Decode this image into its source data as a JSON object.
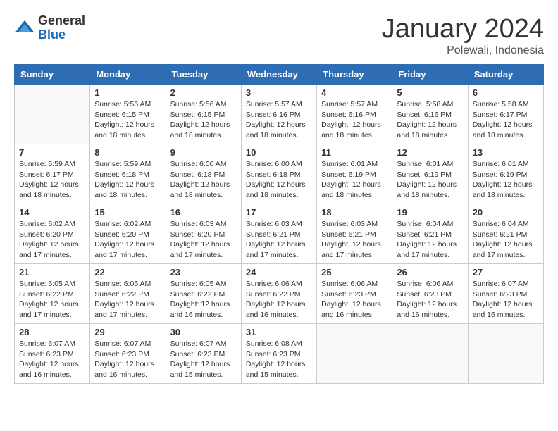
{
  "logo": {
    "general": "General",
    "blue": "Blue"
  },
  "title": "January 2024",
  "location": "Polewali, Indonesia",
  "days_of_week": [
    "Sunday",
    "Monday",
    "Tuesday",
    "Wednesday",
    "Thursday",
    "Friday",
    "Saturday"
  ],
  "weeks": [
    [
      {
        "day": "",
        "sunrise": "",
        "sunset": "",
        "daylight": ""
      },
      {
        "day": "1",
        "sunrise": "Sunrise: 5:56 AM",
        "sunset": "Sunset: 6:15 PM",
        "daylight": "Daylight: 12 hours and 18 minutes."
      },
      {
        "day": "2",
        "sunrise": "Sunrise: 5:56 AM",
        "sunset": "Sunset: 6:15 PM",
        "daylight": "Daylight: 12 hours and 18 minutes."
      },
      {
        "day": "3",
        "sunrise": "Sunrise: 5:57 AM",
        "sunset": "Sunset: 6:16 PM",
        "daylight": "Daylight: 12 hours and 18 minutes."
      },
      {
        "day": "4",
        "sunrise": "Sunrise: 5:57 AM",
        "sunset": "Sunset: 6:16 PM",
        "daylight": "Daylight: 12 hours and 18 minutes."
      },
      {
        "day": "5",
        "sunrise": "Sunrise: 5:58 AM",
        "sunset": "Sunset: 6:16 PM",
        "daylight": "Daylight: 12 hours and 18 minutes."
      },
      {
        "day": "6",
        "sunrise": "Sunrise: 5:58 AM",
        "sunset": "Sunset: 6:17 PM",
        "daylight": "Daylight: 12 hours and 18 minutes."
      }
    ],
    [
      {
        "day": "7",
        "sunrise": "Sunrise: 5:59 AM",
        "sunset": "Sunset: 6:17 PM",
        "daylight": "Daylight: 12 hours and 18 minutes."
      },
      {
        "day": "8",
        "sunrise": "Sunrise: 5:59 AM",
        "sunset": "Sunset: 6:18 PM",
        "daylight": "Daylight: 12 hours and 18 minutes."
      },
      {
        "day": "9",
        "sunrise": "Sunrise: 6:00 AM",
        "sunset": "Sunset: 6:18 PM",
        "daylight": "Daylight: 12 hours and 18 minutes."
      },
      {
        "day": "10",
        "sunrise": "Sunrise: 6:00 AM",
        "sunset": "Sunset: 6:18 PM",
        "daylight": "Daylight: 12 hours and 18 minutes."
      },
      {
        "day": "11",
        "sunrise": "Sunrise: 6:01 AM",
        "sunset": "Sunset: 6:19 PM",
        "daylight": "Daylight: 12 hours and 18 minutes."
      },
      {
        "day": "12",
        "sunrise": "Sunrise: 6:01 AM",
        "sunset": "Sunset: 6:19 PM",
        "daylight": "Daylight: 12 hours and 18 minutes."
      },
      {
        "day": "13",
        "sunrise": "Sunrise: 6:01 AM",
        "sunset": "Sunset: 6:19 PM",
        "daylight": "Daylight: 12 hours and 18 minutes."
      }
    ],
    [
      {
        "day": "14",
        "sunrise": "Sunrise: 6:02 AM",
        "sunset": "Sunset: 6:20 PM",
        "daylight": "Daylight: 12 hours and 17 minutes."
      },
      {
        "day": "15",
        "sunrise": "Sunrise: 6:02 AM",
        "sunset": "Sunset: 6:20 PM",
        "daylight": "Daylight: 12 hours and 17 minutes."
      },
      {
        "day": "16",
        "sunrise": "Sunrise: 6:03 AM",
        "sunset": "Sunset: 6:20 PM",
        "daylight": "Daylight: 12 hours and 17 minutes."
      },
      {
        "day": "17",
        "sunrise": "Sunrise: 6:03 AM",
        "sunset": "Sunset: 6:21 PM",
        "daylight": "Daylight: 12 hours and 17 minutes."
      },
      {
        "day": "18",
        "sunrise": "Sunrise: 6:03 AM",
        "sunset": "Sunset: 6:21 PM",
        "daylight": "Daylight: 12 hours and 17 minutes."
      },
      {
        "day": "19",
        "sunrise": "Sunrise: 6:04 AM",
        "sunset": "Sunset: 6:21 PM",
        "daylight": "Daylight: 12 hours and 17 minutes."
      },
      {
        "day": "20",
        "sunrise": "Sunrise: 6:04 AM",
        "sunset": "Sunset: 6:21 PM",
        "daylight": "Daylight: 12 hours and 17 minutes."
      }
    ],
    [
      {
        "day": "21",
        "sunrise": "Sunrise: 6:05 AM",
        "sunset": "Sunset: 6:22 PM",
        "daylight": "Daylight: 12 hours and 17 minutes."
      },
      {
        "day": "22",
        "sunrise": "Sunrise: 6:05 AM",
        "sunset": "Sunset: 6:22 PM",
        "daylight": "Daylight: 12 hours and 17 minutes."
      },
      {
        "day": "23",
        "sunrise": "Sunrise: 6:05 AM",
        "sunset": "Sunset: 6:22 PM",
        "daylight": "Daylight: 12 hours and 16 minutes."
      },
      {
        "day": "24",
        "sunrise": "Sunrise: 6:06 AM",
        "sunset": "Sunset: 6:22 PM",
        "daylight": "Daylight: 12 hours and 16 minutes."
      },
      {
        "day": "25",
        "sunrise": "Sunrise: 6:06 AM",
        "sunset": "Sunset: 6:23 PM",
        "daylight": "Daylight: 12 hours and 16 minutes."
      },
      {
        "day": "26",
        "sunrise": "Sunrise: 6:06 AM",
        "sunset": "Sunset: 6:23 PM",
        "daylight": "Daylight: 12 hours and 16 minutes."
      },
      {
        "day": "27",
        "sunrise": "Sunrise: 6:07 AM",
        "sunset": "Sunset: 6:23 PM",
        "daylight": "Daylight: 12 hours and 16 minutes."
      }
    ],
    [
      {
        "day": "28",
        "sunrise": "Sunrise: 6:07 AM",
        "sunset": "Sunset: 6:23 PM",
        "daylight": "Daylight: 12 hours and 16 minutes."
      },
      {
        "day": "29",
        "sunrise": "Sunrise: 6:07 AM",
        "sunset": "Sunset: 6:23 PM",
        "daylight": "Daylight: 12 hours and 16 minutes."
      },
      {
        "day": "30",
        "sunrise": "Sunrise: 6:07 AM",
        "sunset": "Sunset: 6:23 PM",
        "daylight": "Daylight: 12 hours and 15 minutes."
      },
      {
        "day": "31",
        "sunrise": "Sunrise: 6:08 AM",
        "sunset": "Sunset: 6:23 PM",
        "daylight": "Daylight: 12 hours and 15 minutes."
      },
      {
        "day": "",
        "sunrise": "",
        "sunset": "",
        "daylight": ""
      },
      {
        "day": "",
        "sunrise": "",
        "sunset": "",
        "daylight": ""
      },
      {
        "day": "",
        "sunrise": "",
        "sunset": "",
        "daylight": ""
      }
    ]
  ]
}
